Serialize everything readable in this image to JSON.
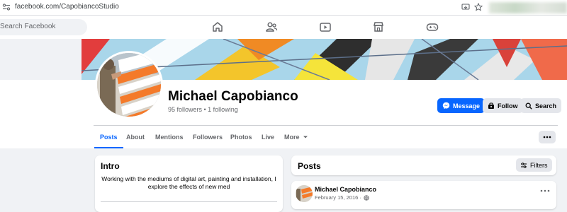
{
  "browser": {
    "url": "facebook.com/CapobiancoStudio"
  },
  "facebook": {
    "search_placeholder": "Search Facebook",
    "nav_icons": [
      "home-icon",
      "friends-icon",
      "video-icon",
      "marketplace-icon",
      "gaming-icon"
    ]
  },
  "profile": {
    "name": "Michael Capobianco",
    "counts": "95 followers • 1 following",
    "buttons": {
      "message": "Message",
      "follow": "Follow",
      "search": "Search"
    }
  },
  "tabs": [
    {
      "label": "Posts"
    },
    {
      "label": "About"
    },
    {
      "label": "Mentions"
    },
    {
      "label": "Followers"
    },
    {
      "label": "Photos"
    },
    {
      "label": "Live"
    },
    {
      "label": "More"
    }
  ],
  "intro": {
    "title": "Intro",
    "bio": "Working with the mediums of digital art, painting and installation, I explore the effects of new med"
  },
  "posts": {
    "title": "Posts",
    "filters_label": "Filters",
    "items": [
      {
        "author": "Michael Capobianco",
        "date": "February 15, 2016 ·"
      }
    ]
  },
  "colors": {
    "accent": "#0866ff",
    "background": "#f0f2f5",
    "secondary_button": "#e4e6eb"
  }
}
